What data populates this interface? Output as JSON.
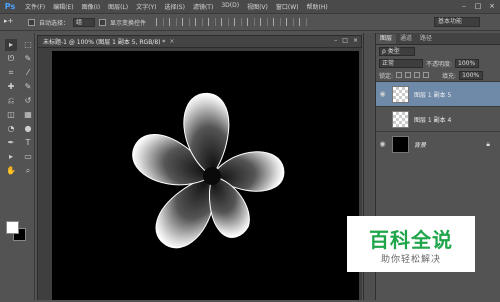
{
  "app": {
    "logo": "Ps",
    "menu": [
      "文件(F)",
      "编辑(E)",
      "图像(I)",
      "图层(L)",
      "文字(Y)",
      "选择(S)",
      "滤镜(T)",
      "3D(D)",
      "视图(V)",
      "窗口(W)",
      "帮助(H)"
    ],
    "window_controls": [
      "–",
      "□",
      "×"
    ]
  },
  "options_bar": {
    "auto_select_label": "自动选择：",
    "auto_select_value": "组",
    "show_transform_label": "显示变换控件",
    "workspace": "基本功能"
  },
  "document": {
    "tab_title": "未标题-1 @ 100% (图层 1 副本 5, RGB/8) *",
    "close": "×",
    "window_controls": [
      "–",
      "□",
      "×"
    ]
  },
  "toolbox": {
    "tools": [
      "move-icon",
      "marquee-icon",
      "lasso-icon",
      "quick-select-icon",
      "crop-icon",
      "eyedropper-icon",
      "heal-icon",
      "brush-icon",
      "stamp-icon",
      "history-brush-icon",
      "eraser-icon",
      "gradient-icon",
      "blur-icon",
      "dodge-icon",
      "pen-icon",
      "type-icon",
      "path-select-icon",
      "shape-icon",
      "hand-icon",
      "zoom-icon"
    ],
    "glyphs": [
      "▸",
      "⬚",
      "ᘎ",
      "✎",
      "⌗",
      "⁄",
      "✚",
      "✎",
      "⎌",
      "↺",
      "◫",
      "▦",
      "◔",
      "●",
      "✒",
      "T",
      "▸",
      "▭",
      "✋",
      "⌕"
    ],
    "foreground": "#ffffff",
    "background": "#000000"
  },
  "layers_panel": {
    "tabs": [
      "图层",
      "通道",
      "路径"
    ],
    "kind_filter": "ρ 类型",
    "blend_mode": "正常",
    "opacity_label": "不透明度:",
    "opacity_value": "100%",
    "lock_label": "锁定:",
    "fill_label": "填充:",
    "fill_value": "100%",
    "layers": [
      {
        "name": "图层 1 副本 5",
        "visible": true,
        "selected": true,
        "thumb": "transparent"
      },
      {
        "name": "图层 1 副本 4",
        "visible": false,
        "selected": false,
        "thumb": "transparent"
      },
      {
        "name": "背景",
        "visible": true,
        "selected": false,
        "thumb": "black",
        "locked": true
      }
    ]
  },
  "watermark": {
    "title": "百科全说",
    "subtitle": "助你轻松解决"
  }
}
